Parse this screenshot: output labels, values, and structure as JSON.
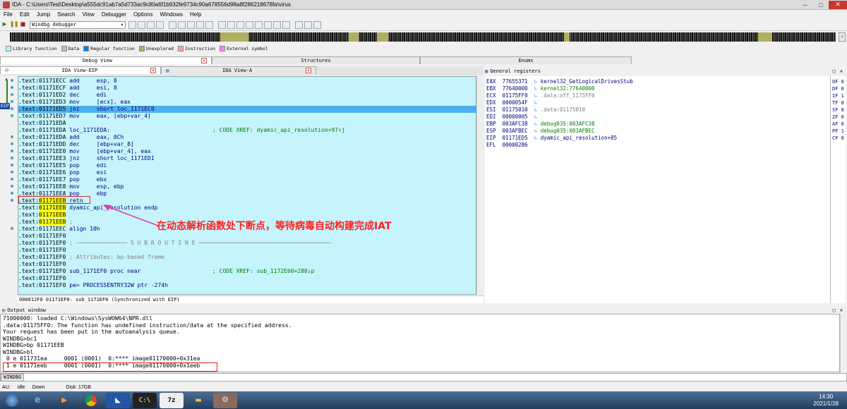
{
  "window": {
    "title": "IDA - C:\\Users\\Test\\Desktop\\a555dc91ab7a5d733ac9c80a6f1b932fe9734c90a678556d98a8f286218678fa\\virus",
    "minimize": "─",
    "maximize": "□",
    "close": "✕"
  },
  "menu": [
    "File",
    "Edit",
    "Jump",
    "Search",
    "View",
    "Debugger",
    "Options",
    "Windows",
    "Help"
  ],
  "toolbar": {
    "debugger_select": "Windbg debugger",
    "play": "▶",
    "pause": "❚❚",
    "stop": "■"
  },
  "legend": [
    {
      "label": "Library function",
      "color": "#c0f0ff"
    },
    {
      "label": "Data",
      "color": "#c0c0c0"
    },
    {
      "label": "Regular function",
      "color": "#0080e0"
    },
    {
      "label": "Unexplored",
      "color": "#b0b060"
    },
    {
      "label": "Instruction",
      "color": "#ffa0a0"
    },
    {
      "label": "External symbol",
      "color": "#ff80ff"
    }
  ],
  "tabs": {
    "debug_view": "Debug View",
    "structures": "Structures",
    "enums": "Enums",
    "ida_view_eip": "IDA View-EIP",
    "ida_view_a": "IDA View-A",
    "general_registers": "General registers",
    "output_window": "Output window"
  },
  "code": [
    {
      "addr": ".text:01171ECC",
      "ins": "add     esp, 8",
      "cmt": ""
    },
    {
      "addr": ".text:01171ECF",
      "ins": "add     esi, 8",
      "cmt": ""
    },
    {
      "addr": ".text:01171ED2",
      "ins": "dec     edi",
      "cmt": ""
    },
    {
      "addr": ".text:01171ED3",
      "ins": "mov     [ecx], eax",
      "cmt": ""
    },
    {
      "addr": ".text:01171ED5",
      "ins": "jnz     short loc_1171EC0",
      "cmt": ""
    },
    {
      "addr": ".text:01171ED7",
      "ins": "mov     eax, [ebp+var_4]",
      "cmt": ""
    },
    {
      "addr": ".text:01171EDA",
      "ins": "",
      "cmt": ""
    },
    {
      "addr": ".text:01171EDA",
      "ins": "loc_1171EDA:",
      "cmt": "; CODE XREF: dyamic_api_resolution+97↑j"
    },
    {
      "addr": ".text:01171EDA",
      "ins": "add     eax, 0Ch",
      "cmt": ""
    },
    {
      "addr": ".text:01171EDD",
      "ins": "dec     [ebp+var_8]",
      "cmt": ""
    },
    {
      "addr": ".text:01171EE0",
      "ins": "mov     [ebp+var_4], eax",
      "cmt": ""
    },
    {
      "addr": ".text:01171EE3",
      "ins": "jnz     short loc_1171ED1",
      "cmt": ""
    },
    {
      "addr": ".text:01171EE5",
      "ins": "pop     edi",
      "cmt": ""
    },
    {
      "addr": ".text:01171EE6",
      "ins": "pop     esi",
      "cmt": ""
    },
    {
      "addr": ".text:01171EE7",
      "ins": "pop     ebx",
      "cmt": ""
    },
    {
      "addr": ".text:01171EE8",
      "ins": "mov     esp, ebp",
      "cmt": ""
    },
    {
      "addr": ".text:01171EEA",
      "ins": "pop     ebp",
      "cmt": ""
    },
    {
      "addr": ".text:01171EEB",
      "ins": "retn",
      "cmt": ""
    },
    {
      "addr": ".text:01171EEB",
      "ins": "dyamic_api_resolution endp",
      "cmt": ""
    },
    {
      "addr": ".text:01171EEB",
      "ins": "",
      "cmt": ""
    },
    {
      "addr": ".text:01171EEB",
      "ins": ";",
      "cmt": ""
    },
    {
      "addr": ".text:01171EEC",
      "ins": "align 10h",
      "cmt": ""
    },
    {
      "addr": ".text:01171EF0",
      "ins": "",
      "cmt": ""
    },
    {
      "addr": ".text:01171EF0",
      "ins": "; ─────────────── S U B R O U T I N E ───────────────────────────────────────",
      "cmt": ""
    },
    {
      "addr": ".text:01171EF0",
      "ins": "",
      "cmt": ""
    },
    {
      "addr": ".text:01171EF0",
      "ins": "; Attributes: bp-based frame",
      "cmt": ""
    },
    {
      "addr": ".text:01171EF0",
      "ins": "",
      "cmt": ""
    },
    {
      "addr": ".text:01171EF0",
      "ins": "sub_1171EF0 proc near",
      "cmt": "; CODE XREF: sub_1172E60+288↓p"
    },
    {
      "addr": ".text:01171EF0",
      "ins": "",
      "cmt": ""
    },
    {
      "addr": ".text:01171EF0",
      "ins": "pe= PROCESSENTRY32W ptr -274h",
      "cmt": ""
    }
  ],
  "code_status": "000012F0 01171EF0: sub_1171EF0 (Synchronized with EIP)",
  "eip_marker": "EIP",
  "annotation": "在动态解析函数处下断点，等待病毒自动构建完成IAT",
  "registers": [
    {
      "name": "EAX",
      "val": "77655371",
      "label": "kernel32_GetLogicalDrivesStub"
    },
    {
      "name": "EBX",
      "val": "77640000",
      "label": "kernel32:77640000"
    },
    {
      "name": "ECX",
      "val": "01175FF0",
      "label": ".data:off_1175FF0"
    },
    {
      "name": "EDX",
      "val": "0000054F",
      "label": ""
    },
    {
      "name": "ESI",
      "val": "01175010",
      "label": ".data:01175010"
    },
    {
      "name": "EDI",
      "val": "00000005",
      "label": ""
    },
    {
      "name": "EBP",
      "val": "003AFC38",
      "label": "debug035:003AFC38"
    },
    {
      "name": "ESP",
      "val": "003AFBEC",
      "label": "debug035:003AFBEC"
    },
    {
      "name": "EIP",
      "val": "01171ED5",
      "label": "dyamic_api_resolution+85"
    },
    {
      "name": "EFL",
      "val": "00000286",
      "label": ""
    }
  ],
  "flags": [
    "OF 0",
    "DF 0",
    "IF 1",
    "TF 0",
    "SF 0",
    "ZF 0",
    "AF 0",
    "PF 1",
    "CF 0"
  ],
  "output": [
    "71000000: loaded C:\\Windows\\SysWOW64\\NPR.dll",
    ".data:01175FF0: The function has undefined instruction/data at the specified address.",
    "Your request has been put in the autoanalysis queue.",
    "WINDBG>bc1",
    "WINDBG>bp 01171EEB",
    "WINDBG>bl",
    " 0 e 011731ea     0001 (0001)  0:**** image01170000+0x31ea",
    " 1 e 01171eeb     0001 (0001)  0:**** image01170000+0x1eeb"
  ],
  "command_label": "WINDBG",
  "status": {
    "au": "AU:",
    "state": "idle",
    "dir": "Down",
    "disk": "Disk: 17GB"
  },
  "clock": {
    "time": "14:30",
    "date": "2021/1/28"
  }
}
